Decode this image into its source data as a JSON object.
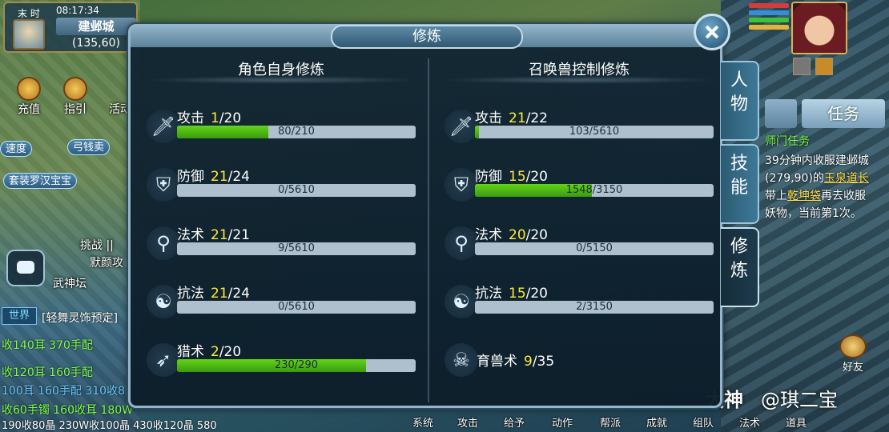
{
  "minimap": {
    "time_label": "末 时",
    "clock": "08:17:34",
    "city": "建邺城",
    "coords": "(135,60)"
  },
  "left_buttons": {
    "recharge": "充值",
    "guide": "指引",
    "activity": "活动",
    "sell_bow": "弓钱卖",
    "set_pet": "套装罗汉宝宝",
    "challenge": "挑战 ||",
    "silent": "默颜攻",
    "martial": "武神坛",
    "speed": "速度"
  },
  "chat": {
    "world_tag": "世界",
    "lines": [
      "[轻舞灵饰预定]",
      "收140耳 370手配",
      "收120耳 160手配",
      "100耳 160手配 310收8",
      "收60手镯 160收耳 180W",
      "190收80晶 230W收100晶 430收120晶 580"
    ]
  },
  "dialog": {
    "title": "修炼",
    "left_title": "角色自身修炼",
    "right_title": "召唤兽控制修炼"
  },
  "self_training": [
    {
      "icon": "sword-icon",
      "name": "攻击",
      "level": "1",
      "max": "/20",
      "bar_text": "80/210",
      "progress": 0.381
    },
    {
      "icon": "shield-icon",
      "name": "防御",
      "level": "21",
      "max": "/24",
      "bar_text": "0/5610",
      "progress": 0.0
    },
    {
      "icon": "staff-icon",
      "name": "法术",
      "level": "21",
      "max": "/21",
      "bar_text": "9/5610",
      "progress": 0.0016
    },
    {
      "icon": "yinyang-icon",
      "name": "抗法",
      "level": "21",
      "max": "/24",
      "bar_text": "0/5610",
      "progress": 0.0
    },
    {
      "icon": "bow-icon",
      "name": "猎术",
      "level": "2",
      "max": "/20",
      "bar_text": "230/290",
      "progress": 0.793
    }
  ],
  "pet_training": [
    {
      "icon": "sword-icon",
      "name": "攻击",
      "level": "21",
      "max": "/22",
      "bar_text": "103/5610",
      "progress": 0.018
    },
    {
      "icon": "shield-icon",
      "name": "防御",
      "level": "15",
      "max": "/20",
      "bar_text": "1548/3150",
      "progress": 0.491
    },
    {
      "icon": "staff-icon",
      "name": "法术",
      "level": "20",
      "max": "/20",
      "bar_text": "0/5150",
      "progress": 0.0
    },
    {
      "icon": "yinyang-icon",
      "name": "抗法",
      "level": "15",
      "max": "/20",
      "bar_text": "2/3150",
      "progress": 0.0006
    },
    {
      "icon": "skull-icon",
      "name": "育兽术",
      "level": "9",
      "max": "/35"
    }
  ],
  "side_tabs": [
    {
      "label": "人物",
      "active": false
    },
    {
      "label": "技能",
      "active": false
    },
    {
      "label": "修炼",
      "active": true
    }
  ],
  "task": {
    "tab": "任务",
    "title": "师门任务",
    "line1": "39分钟内收服建邺城",
    "line2a": "(279,90)的",
    "line2b": "玉泉道长",
    "line3a": "带上",
    "line3b": "乾坤袋",
    "line3c": "再去收服",
    "line4": "妖物，当前第1次。"
  },
  "friend": "好友",
  "bottom_bar": [
    "系统",
    "攻击",
    "给予",
    "动作",
    "帮派",
    "成就",
    "组队",
    "法术",
    "道具"
  ],
  "watermark": {
    "brand": "大神",
    "user": "@琪二宝"
  }
}
